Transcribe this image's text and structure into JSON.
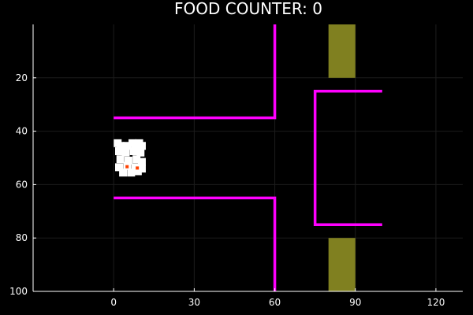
{
  "game": {
    "title": "FOOD COUNTER: 0",
    "colors": {
      "background": "#000000",
      "walls": "#ff00ff",
      "food": "#808020",
      "agent": "#ffffff",
      "agent_marker": "#ff4000",
      "axis": "#ffffff"
    }
  },
  "chart_data": {
    "type": "scatter",
    "title": "FOOD COUNTER: 0",
    "xlabel": "",
    "ylabel": "",
    "xlim": [
      -30,
      130
    ],
    "ylim": [
      100,
      0
    ],
    "y_inverted": true,
    "grid": true,
    "legend": "none",
    "x_ticks": [
      0,
      30,
      60,
      90,
      120
    ],
    "y_ticks": [
      20,
      40,
      60,
      80,
      100
    ],
    "walls": [
      {
        "name": "upper-corridor-wall",
        "points": [
          [
            0,
            35
          ],
          [
            60,
            35
          ],
          [
            60,
            0
          ]
        ]
      },
      {
        "name": "lower-corridor-wall",
        "points": [
          [
            0,
            65
          ],
          [
            60,
            65
          ],
          [
            60,
            100
          ]
        ]
      },
      {
        "name": "right-bracket-wall",
        "points": [
          [
            100,
            25
          ],
          [
            75,
            25
          ],
          [
            75,
            75
          ],
          [
            100,
            75
          ]
        ]
      }
    ],
    "food_sources": [
      {
        "name": "top-food",
        "x": [
          80,
          90
        ],
        "y": [
          0,
          20
        ]
      },
      {
        "name": "bottom-food",
        "x": [
          80,
          90
        ],
        "y": [
          80,
          100
        ]
      }
    ],
    "agents": [
      {
        "x": 1.5,
        "y": 44.5
      },
      {
        "x": 7.0,
        "y": 44.5
      },
      {
        "x": 9.5,
        "y": 44.5
      },
      {
        "x": 2.5,
        "y": 45.5
      },
      {
        "x": 5.0,
        "y": 45.5
      },
      {
        "x": 8.0,
        "y": 45.5
      },
      {
        "x": 10.5,
        "y": 45.5
      },
      {
        "x": 2.0,
        "y": 47.5
      },
      {
        "x": 4.5,
        "y": 48.0
      },
      {
        "x": 7.5,
        "y": 47.5
      },
      {
        "x": 10.0,
        "y": 48.0
      },
      {
        "x": 2.5,
        "y": 50.5
      },
      {
        "x": 5.5,
        "y": 51.0
      },
      {
        "x": 8.5,
        "y": 50.5
      },
      {
        "x": 10.5,
        "y": 51.5
      },
      {
        "x": 2.0,
        "y": 53.5
      },
      {
        "x": 5.0,
        "y": 53.0
      },
      {
        "x": 8.0,
        "y": 53.5
      },
      {
        "x": 10.5,
        "y": 54.0
      },
      {
        "x": 3.5,
        "y": 55.5
      },
      {
        "x": 6.5,
        "y": 55.5
      },
      {
        "x": 9.0,
        "y": 55.0
      }
    ],
    "agent_markers": [
      {
        "x": 5.0,
        "y": 53.3
      },
      {
        "x": 8.8,
        "y": 53.8
      }
    ]
  }
}
